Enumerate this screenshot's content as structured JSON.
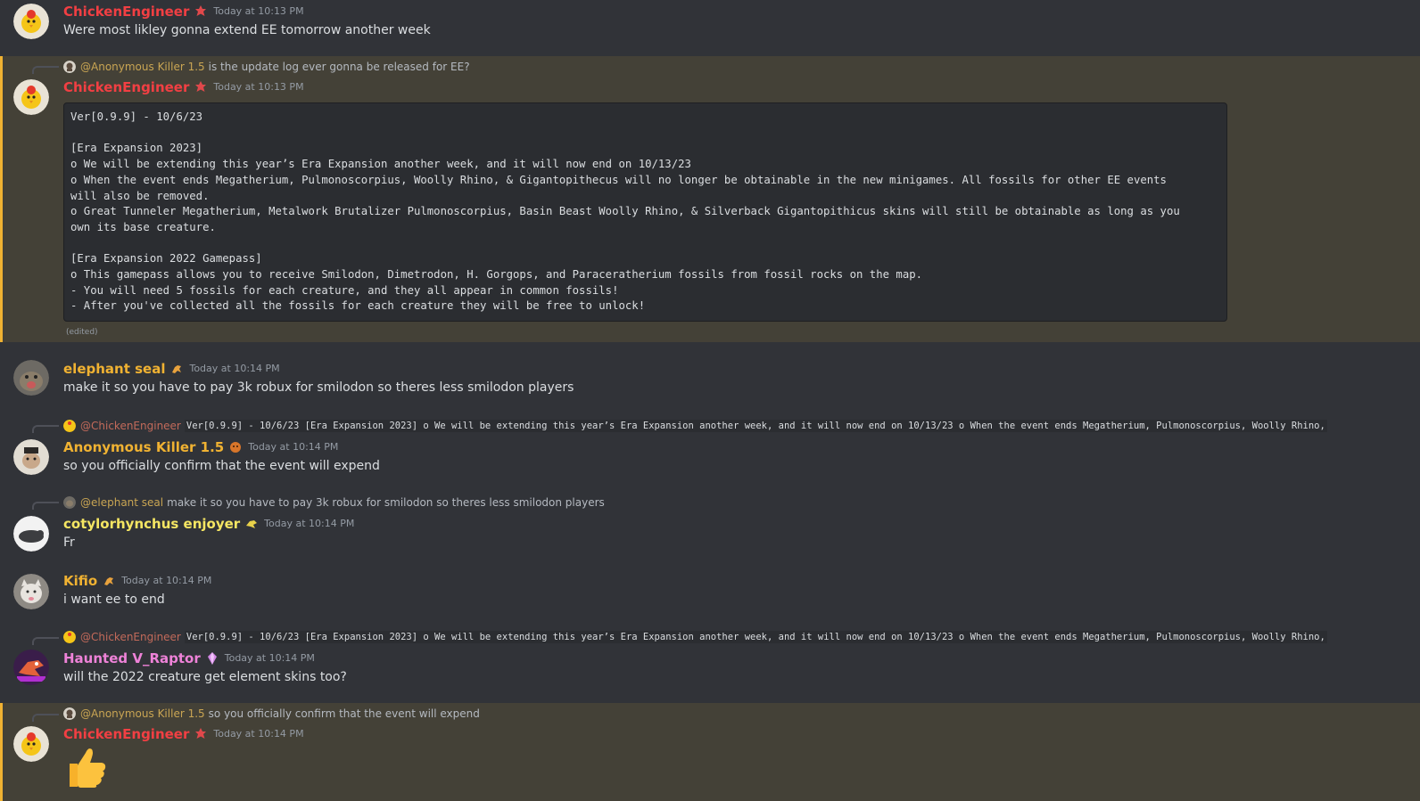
{
  "colors": {
    "background": "#313338",
    "mention_bg": "#444137",
    "mention_bar": "#f0b232"
  },
  "messages": [
    {
      "author": "ChickenEngineer",
      "author_color": "#f23f43",
      "timestamp": "Today at 10:13 PM",
      "text": "Were most likley gonna extend EE tomorrow another week"
    },
    {
      "reply": {
        "name": "@Anonymous Killer 1.5",
        "text": "is the update log ever gonna be released for EE?"
      },
      "author": "ChickenEngineer",
      "author_color": "#f23f43",
      "timestamp": "Today at 10:13 PM",
      "code_lines": [
        "Ver[0.9.9] - 10/6/23",
        "",
        "[Era Expansion 2023]",
        "o We will be extending this year’s Era Expansion another week, and it will now end on 10/13/23",
        "o When the event ends Megatherium, Pulmonoscorpius, Woolly Rhino, & Gigantopithecus will no longer be obtainable in the new minigames. All fossils for other EE events",
        "will also be removed.",
        "o Great Tunneler Megatherium, Metalwork Brutalizer Pulmonoscorpius, Basin Beast Woolly Rhino, & Silverback Gigantopithicus skins will still be obtainable as long as you",
        "own its base creature.",
        "",
        "[Era Expansion 2022 Gamepass]",
        "o This gamepass allows you to receive Smilodon, Dimetrodon, H. Gorgops, and Paraceratherium fossils from fossil rocks on the map.",
        "- You will need 5 fossils for each creature, and they all appear in common fossils!",
        "- After you've collected all the fossils for each creature they will be free to unlock!"
      ],
      "edited": "(edited)"
    },
    {
      "author": "elephant seal",
      "author_color": "#f0b232",
      "timestamp": "Today at 10:14 PM",
      "text": "make it so you have to pay 3k robux for smilodon so theres less smilodon players"
    },
    {
      "reply": {
        "name": "@ChickenEngineer",
        "code": "Ver[0.9.9] - 10/6/23  [Era Expansion 2023] o We will be extending this year’s Era Expansion another week, and it will now end on 10/13/23 o When the event ends Megatherium, Pulmonoscorpius, Woolly Rhino,"
      },
      "author": "Anonymous Killer 1.5",
      "author_color": "#f0b232",
      "timestamp": "Today at 10:14 PM",
      "text": "so you officially confirm that the event will expend"
    },
    {
      "reply": {
        "name": "@elephant seal",
        "text": "make it so you have to pay 3k robux for smilodon so theres less smilodon players"
      },
      "author": "cotylorhynchus enjoyer",
      "author_color": "#f5e663",
      "timestamp": "Today at 10:14 PM",
      "text": "Fr"
    },
    {
      "author": "Kifio",
      "author_color": "#f0b232",
      "timestamp": "Today at 10:14 PM",
      "text": "i want ee to end"
    },
    {
      "reply": {
        "name": "@ChickenEngineer",
        "code": "Ver[0.9.9] - 10/6/23  [Era Expansion 2023] o We will be extending this year’s Era Expansion another week, and it will now end on 10/13/23 o When the event ends Megatherium, Pulmonoscorpius, Woolly Rhino,"
      },
      "author": "Haunted V_Raptor",
      "author_color": "#ee82d8",
      "timestamp": "Today at 10:14 PM",
      "text": "will the 2022 creature get element skins too?"
    },
    {
      "reply": {
        "name": "@Anonymous Killer 1.5",
        "text": "so you officially confirm that the event will expend"
      },
      "author": "ChickenEngineer",
      "author_color": "#f23f43",
      "timestamp": "Today at 10:14 PM",
      "emoji": "thumbs-up-emoji"
    }
  ]
}
